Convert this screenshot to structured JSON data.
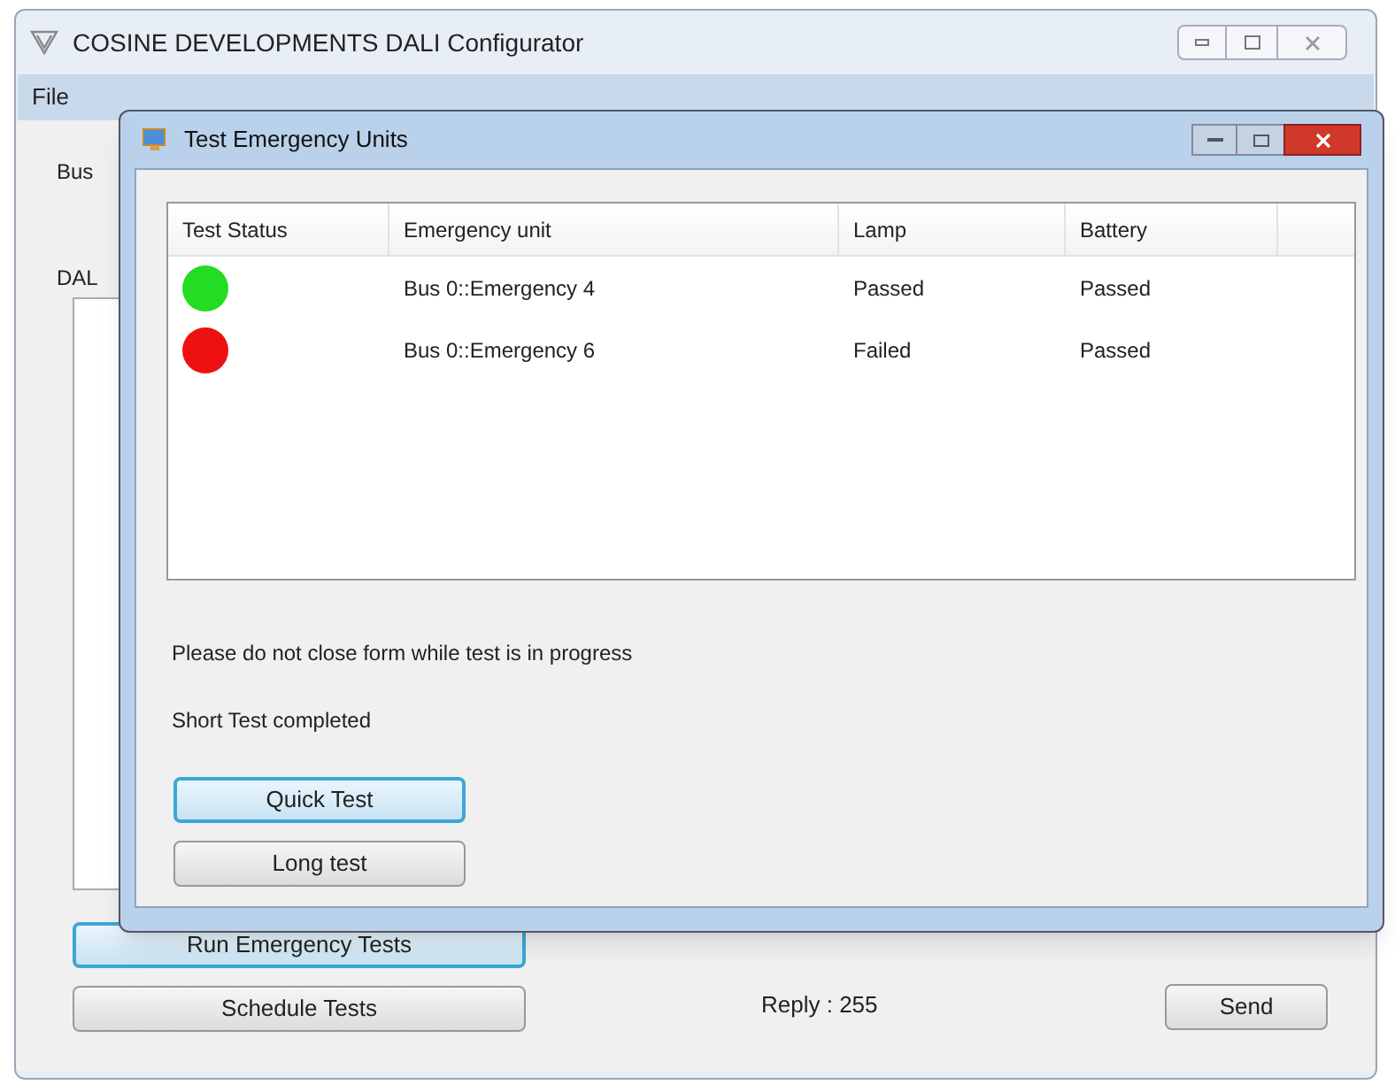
{
  "main_window": {
    "title": "COSINE DEVELOPMENTS DALI Configurator",
    "menu": [
      "File"
    ],
    "tab_label": "Bus",
    "group_label": "DAL",
    "buttons": [
      {
        "label": "Run Emergency Tests",
        "selected": true
      },
      {
        "label": "Schedule Tests",
        "selected": false
      }
    ],
    "reply": "Reply : 255",
    "send_button": "Send"
  },
  "dialog": {
    "title": "Test Emergency Units",
    "columns": [
      "Test Status",
      "Emergency unit",
      "Lamp",
      "Battery"
    ],
    "rows": [
      {
        "color": "#22dd22",
        "unit": "Bus 0::Emergency 4",
        "lamp": "Passed",
        "battery": "Passed"
      },
      {
        "color": "#ee1111",
        "unit": "Bus 0::Emergency 6",
        "lamp": "Failed",
        "battery": "Passed"
      }
    ],
    "notice": "Please do not close form while test is in progress",
    "status": "Short Test completed",
    "buttons": [
      {
        "label": "Quick Test",
        "selected": true
      },
      {
        "label": "Long test",
        "selected": false
      }
    ]
  }
}
